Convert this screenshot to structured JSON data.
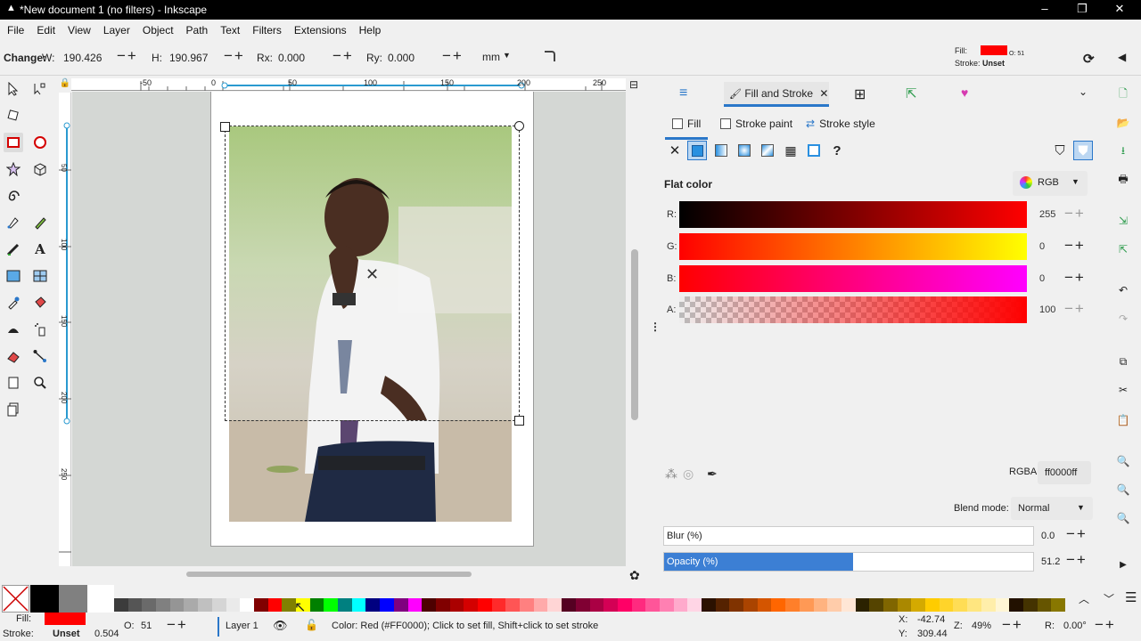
{
  "window": {
    "title": "*New document 1 (no filters) - Inkscape",
    "minimize": "–",
    "maximize": "❐",
    "close": "✕"
  },
  "menu": [
    "File",
    "Edit",
    "View",
    "Layer",
    "Object",
    "Path",
    "Text",
    "Filters",
    "Extensions",
    "Help"
  ],
  "controls": {
    "change_label": "Change:",
    "w_label": "W:",
    "w_value": "190.426",
    "h_label": "H:",
    "h_value": "190.967",
    "rx_label": "Rx:",
    "rx_value": "0.000",
    "ry_label": "Ry:",
    "ry_value": "0.000",
    "unit": "mm",
    "fill_label": "Fill:",
    "stroke_label": "Stroke:",
    "stroke_value": "Unset",
    "opacity_small": "O: 51"
  },
  "ruler": {
    "top_ticks": [
      "-50",
      "0",
      "50",
      "100",
      "150",
      "200",
      "250"
    ],
    "left_ticks": [
      "50",
      "100",
      "150",
      "200",
      "250"
    ]
  },
  "panel": {
    "tab_title": "Fill and Stroke",
    "sub_fill": "Fill",
    "sub_stroke_paint": "Stroke paint",
    "sub_stroke_style": "Stroke style",
    "mode_title": "Flat color",
    "color_model": "RGB",
    "channels": [
      {
        "label": "R:",
        "value": "255"
      },
      {
        "label": "G:",
        "value": "0"
      },
      {
        "label": "B:",
        "value": "0"
      },
      {
        "label": "A:",
        "value": "100"
      }
    ],
    "rgba_label": "RGBA:",
    "rgba_value": "ff0000ff",
    "blend_label": "Blend mode:",
    "blend_value": "Normal",
    "blur_label": "Blur (%)",
    "blur_value": "0.0",
    "opacity_label": "Opacity (%)",
    "opacity_value": "51.2",
    "opacity_fraction": 0.512,
    "unknown_icon": "?"
  },
  "colors": {
    "fill": "#ff0000",
    "accent": "#2a77c9",
    "opacity_bar": "#3c7fd4"
  },
  "palette": [
    "#000000",
    "#808080",
    "#ffffff",
    "#3c3c3c",
    "#555555",
    "#6a6a6a",
    "#808080",
    "#959595",
    "#aaaaaa",
    "#c0c0c0",
    "#d5d5d5",
    "#eaeaea",
    "#ffffff",
    "#800000",
    "#ff0000",
    "#808000",
    "#ffff00",
    "#008000",
    "#00ff00",
    "#008080",
    "#00ffff",
    "#000080",
    "#0000ff",
    "#800080",
    "#ff00ff",
    "#4d0000",
    "#800000",
    "#aa0000",
    "#d40000",
    "#ff0000",
    "#ff2a2a",
    "#ff5555",
    "#ff8080",
    "#ffaaaa",
    "#ffd5d5",
    "#550022",
    "#800033",
    "#aa0044",
    "#d40055",
    "#ff0066",
    "#ff2a7f",
    "#ff5599",
    "#ff80b2",
    "#ffaacc",
    "#ffd5e5",
    "#2b1100",
    "#552200",
    "#803300",
    "#aa4400",
    "#d45500",
    "#ff6600",
    "#ff7f2a",
    "#ff9955",
    "#ffb380",
    "#ffccaa",
    "#ffe6d5",
    "#2b2200",
    "#554400",
    "#806600",
    "#aa8800",
    "#d4aa00",
    "#ffcc00",
    "#ffd42a",
    "#ffdd55",
    "#ffe680",
    "#ffeeaa",
    "#fff6d5",
    "#221100",
    "#443300",
    "#665500",
    "#887700"
  ],
  "status": {
    "fill_label": "Fill:",
    "stroke_label": "Stroke:",
    "stroke_value": "Unset",
    "stroke_width": "0.504",
    "o_label": "O:",
    "o_value": "51",
    "layer": "Layer 1",
    "message": "Color: Red (#FF0000); Click to set fill, Shift+click to set stroke",
    "x_label": "X:",
    "x_value": "-42.74",
    "y_label": "Y:",
    "y_value": "309.44",
    "z_label": "Z:",
    "zoom": "49%",
    "r_label": "R:",
    "rotation": "0.00°"
  }
}
